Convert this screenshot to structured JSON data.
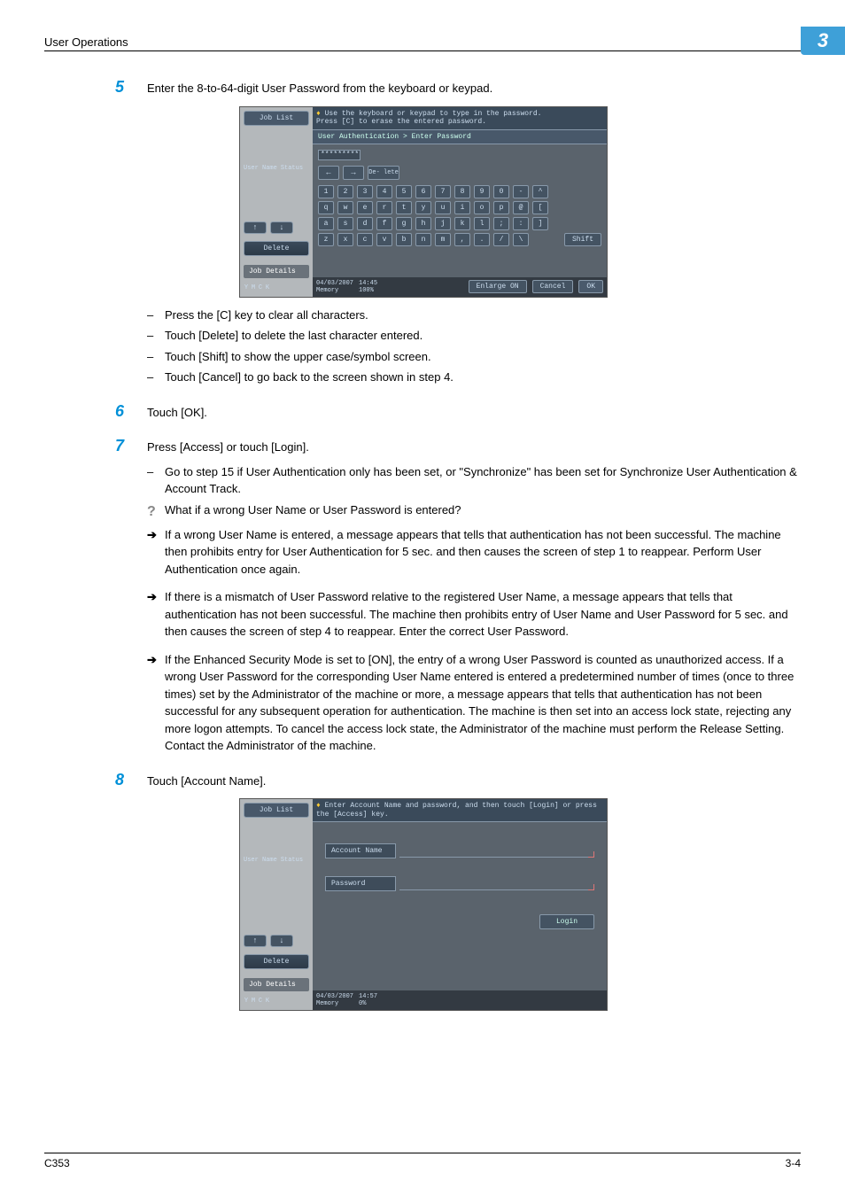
{
  "header": {
    "section": "User Operations",
    "chapter": "3"
  },
  "steps": {
    "s5": {
      "num": "5",
      "text": "Enter the 8-to-64-digit User Password from the keyboard or keypad."
    },
    "s6": {
      "num": "6",
      "text": "Touch [OK]."
    },
    "s7": {
      "num": "7",
      "text": "Press [Access] or touch [Login]."
    },
    "s8": {
      "num": "8",
      "text": "Touch [Account Name]."
    }
  },
  "sub5": {
    "a": "Press the [C] key to clear all characters.",
    "b": "Touch [Delete] to delete the last character entered.",
    "c": "Touch [Shift] to show the upper case/symbol screen.",
    "d": "Touch [Cancel] to go back to the screen shown in step 4."
  },
  "sub7": {
    "a": "Go to step 15 if User Authentication only has been set, or \"Synchronize\" has been set for Synchronize User Authentication & Account Track.",
    "q": "What if a wrong User Name or User Password is entered?",
    "b": "If a wrong User Name is entered, a message appears that tells that authentication has not been successful. The machine then prohibits entry for User Authentication for 5 sec. and then causes the screen of step 1 to reappear. Perform User Authentication once again.",
    "c": "If there is a mismatch of User Password relative to the registered User Name, a message appears that tells that authentication has not been successful. The machine then prohibits entry of User Name and User Password for 5 sec. and then causes the screen of step 4 to reappear. Enter the correct User Password.",
    "d": "If the Enhanced Security Mode is set to [ON], the entry of a wrong User Password is counted as unauthorized access. If a wrong User Password for the corresponding User Name entered is entered a predetermined number of times (once to three times) set by the Administrator of the machine or more, a message appears that tells that authentication has not been successful for any subsequent operation for authentication. The machine is then set into an access lock state, rejecting any more logon attempts. To cancel the access lock state, the Administrator of the machine must perform the Release Setting. Contact the Administrator of the machine."
  },
  "screen1": {
    "jobList": "Job List",
    "userName": "User Name",
    "status": "Status",
    "upIcon": "↑",
    "downIcon": "↓",
    "delete": "Delete",
    "jobDetails": "Job Details",
    "info1": "Use the keyboard or keypad to type in the password.",
    "info2": "Press [C] to erase the entered password.",
    "breadcrumb": "User Authentication > Enter Password",
    "maskedValue": "*********",
    "navLeft": "←",
    "navRight": "→",
    "navDelete": "De- lete",
    "row1": [
      "1",
      "2",
      "3",
      "4",
      "5",
      "6",
      "7",
      "8",
      "9",
      "0",
      "-",
      "^"
    ],
    "row2": [
      "q",
      "w",
      "e",
      "r",
      "t",
      "y",
      "u",
      "i",
      "o",
      "p",
      "@",
      "["
    ],
    "row3": [
      "a",
      "s",
      "d",
      "f",
      "g",
      "h",
      "j",
      "k",
      "l",
      ";",
      ":",
      "]"
    ],
    "row4": [
      "z",
      "x",
      "c",
      "v",
      "b",
      "n",
      "m",
      ",",
      ".",
      "/",
      "\\"
    ],
    "shift": "Shift",
    "date": "04/03/2007",
    "time": "14:45",
    "memory": "Memory",
    "memval": "100%",
    "enlarge": "Enlarge ON",
    "cancel": "Cancel",
    "ok": "OK",
    "toners": [
      "Y",
      "M",
      "C",
      "K"
    ]
  },
  "screen2": {
    "jobList": "Job List",
    "userName": "User Name",
    "status": "Status",
    "upIcon": "↑",
    "downIcon": "↓",
    "delete": "Delete",
    "jobDetails": "Job Details",
    "info1": "Enter Account Name and password, and then touch [Login] or press the [Access] key.",
    "accountName": "Account Name",
    "password": "Password",
    "login": "Login",
    "date": "04/03/2007",
    "time": "14:57",
    "memory": "Memory",
    "memval": "0%",
    "toners": [
      "Y",
      "M",
      "C",
      "K"
    ]
  },
  "footer": {
    "model": "C353",
    "page": "3-4"
  }
}
